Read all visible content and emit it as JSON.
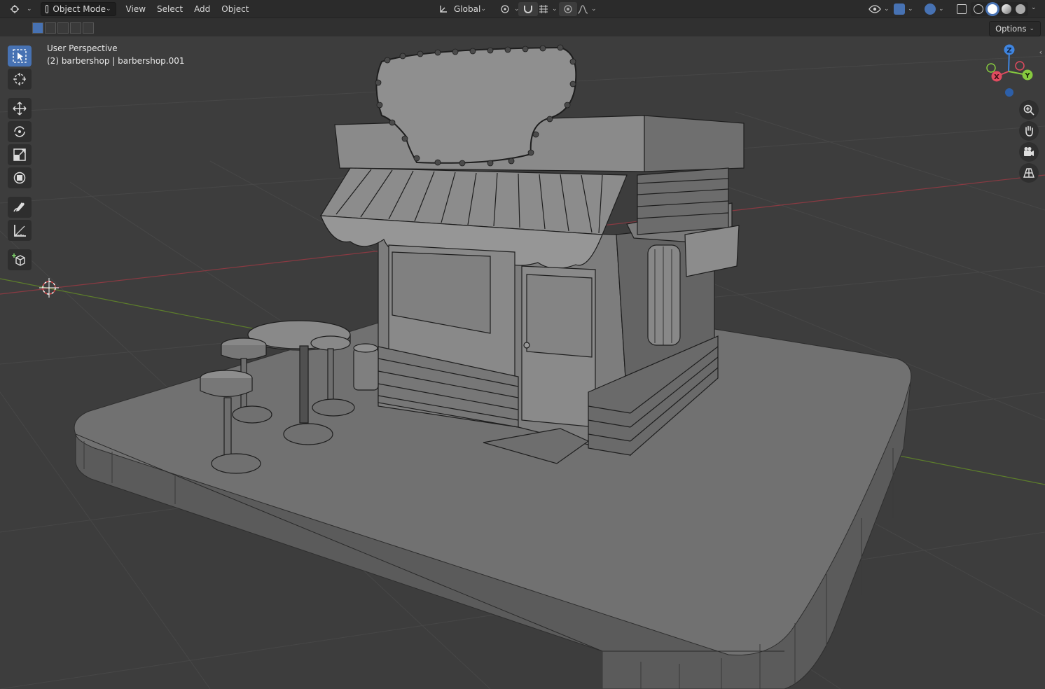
{
  "header": {
    "mode": "Object Mode",
    "menus": [
      "View",
      "Select",
      "Add",
      "Object"
    ],
    "transform_orientation": "Global"
  },
  "viewport": {
    "view_name": "User Perspective",
    "object_info": "(2) barbershop | barbershop.001",
    "options_label": "Options"
  },
  "gizmo": {
    "axes": [
      "Z",
      "Y",
      "X"
    ],
    "colors": {
      "x": "#e04b5f",
      "y": "#86c93f",
      "z": "#3f85e0"
    }
  },
  "toolbar": {
    "tools": [
      "select-box",
      "cursor",
      "move",
      "rotate",
      "scale",
      "transform",
      "annotate",
      "measure",
      "add-cube"
    ],
    "active": "select-box"
  },
  "nav": [
    "zoom",
    "pan",
    "camera",
    "ortho"
  ],
  "theme": {
    "accent": "#4772b3",
    "background": "#3d3d3d"
  }
}
